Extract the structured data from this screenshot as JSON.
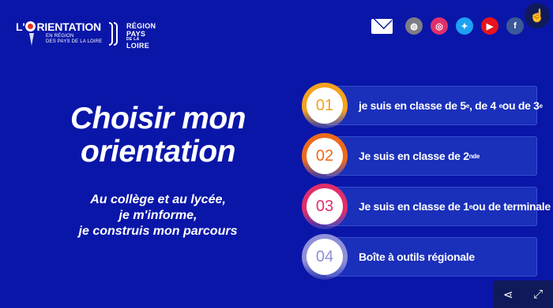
{
  "header": {
    "logo": {
      "title_prefix": "L'",
      "title_rest": "RIENTATION",
      "subtitle_line1": "EN RÉGION",
      "subtitle_line2": "DES PAYS DE LA LOIRE"
    },
    "region_logo": {
      "line1": "RÉGION",
      "line2": "PAYS",
      "line_small": "DE LA",
      "line3": "LOIRE"
    },
    "icons": [
      "mail-icon",
      "globe-icon",
      "instagram-icon",
      "twitter-icon",
      "youtube-icon",
      "facebook-icon"
    ],
    "accessibility_icon": "accessibility-icon"
  },
  "hero": {
    "title_line1": "Choisir mon",
    "title_line2": "orientation",
    "tagline_line1": "Au collège et au lycée,",
    "tagline_line2": "je m'informe,",
    "tagline_line3": "je construis mon parcours"
  },
  "menu": {
    "items": [
      {
        "number": "01",
        "ring_color": "#f4a21c",
        "number_color": "#f4a21c",
        "text": [
          "je suis en classe de 5",
          "e",
          ", de 4",
          "e",
          " ou de 3",
          "e"
        ]
      },
      {
        "number": "02",
        "ring_color": "#ee6a1a",
        "number_color": "#ee6a1a",
        "text": [
          "Je suis en classe de 2",
          "nde"
        ]
      },
      {
        "number": "03",
        "ring_color": "#e02e6b",
        "number_color": "#e02e6b",
        "text": [
          "Je suis en classe de 1",
          "e",
          " ou de terminale"
        ]
      },
      {
        "number": "04",
        "ring_color": "#8e8fd8",
        "number_color": "#8e8fd8",
        "text": [
          "Boîte à outils régionale"
        ]
      }
    ]
  },
  "footer": {
    "share_icon": "share-icon",
    "fullscreen_icon": "fullscreen-icon"
  }
}
